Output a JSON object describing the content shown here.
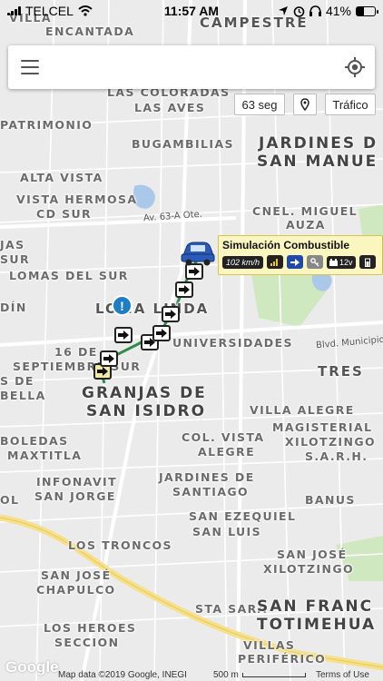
{
  "status_bar": {
    "carrier": "TELCEL",
    "time": "11:57 AM",
    "battery": "41%",
    "battery_level": 0.41
  },
  "search": {
    "placeholder": "",
    "menu_icon": "hamburger-menu-icon",
    "locate_icon": "my-location-icon"
  },
  "controls": {
    "refresh": "63 seg",
    "pin_icon": "map-pin-icon",
    "traffic": "Tráfico"
  },
  "popup": {
    "title": "Simulación Combustible",
    "speed": "102 km/h",
    "voltage": "12v"
  },
  "map": {
    "labels": [
      "VILLA",
      "ENCANTADA",
      "CAMPESTRE",
      "LAS COLORADAS",
      "LAS AVES",
      "PATRIMONIO",
      "BUGAMBILIAS",
      "JARDINES D",
      "SAN MANUE",
      "ALTA VISTA",
      "VISTA HERMOSA",
      "CD SUR",
      "CNEL. MIGUEL",
      "AUZA",
      "JAS",
      "SUR",
      "LOMAS DEL SUR",
      "DÍN",
      "LOMA LINDA",
      "UNIVERSIDADES",
      "16 DE",
      "SEPTIEMBRE SUR",
      "S DE",
      "BELLA",
      "GRANJAS DE",
      "SAN ISIDRO",
      "TRES",
      "VILLA ALEGRE",
      "MAGISTERIAL",
      "XILOTZINGO",
      "S.A.R.H.",
      "BOLEDAS",
      "MAXTITLA",
      "COL. VISTA",
      "ALEGRE",
      "INFONAVIT",
      "SAN JORGE",
      "OL",
      "JARDINES DE",
      "SANTIAGO",
      "BANUS",
      "SAN EZEQUIEL",
      "SAN LUIS",
      "LOS TRONCOS",
      "SAN JOSÉ",
      "XILOTZINGO",
      "SAN JOSÉ",
      "CHAPULCO",
      "STA SARA",
      "SAN FRANC",
      "TOTIMEHUA",
      "LOS HEROES",
      "SECCION",
      "VILLAS",
      "PERIFÉRICO"
    ],
    "roads": [
      "Av. 63-A Ote.",
      "Blvd. Municipio"
    ]
  },
  "footer": {
    "logo": "Google",
    "attribution": "Map data ©2019 Google, INEGI",
    "scale": "500 m",
    "terms": "Terms of Use"
  },
  "colors": {
    "route": "#2e8b4a",
    "popup_bg": "#fbf5c0",
    "park": "#cfe8c0",
    "water": "#aac9ea",
    "highway": "#f6e08a"
  }
}
